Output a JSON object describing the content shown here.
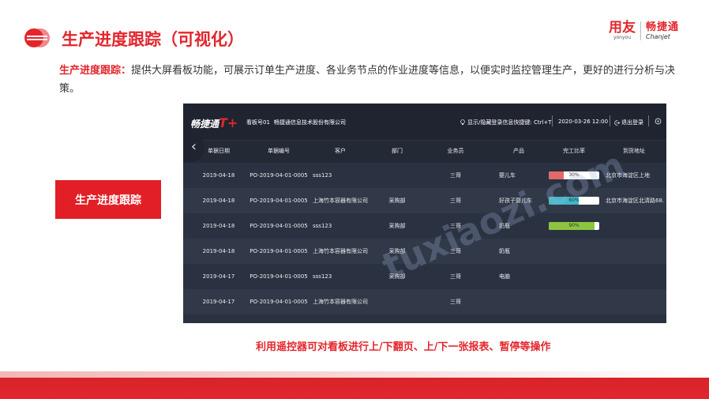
{
  "slide": {
    "title": "生产进度跟踪（可视化）",
    "brand": {
      "yonyou_cn": "用友",
      "yonyou_en": "yonyou",
      "chanjet_cn": "畅捷通",
      "chanjet_en": "Chanjet"
    },
    "desc_label": "生产进度跟踪：",
    "desc_text": "提供大屏看板功能，可展示订单生产进度、各业务节点的作业进度等信息，以便实时监控管理生产，更好的进行分析与决策。",
    "button_label": "生产进度跟踪",
    "caption": "利用遥控器可对看板进行上/下翻页、上/下一张报表、暂停等操作",
    "watermark": "tuxiaozi.com"
  },
  "board": {
    "logo": "畅捷通",
    "logo_suffix": "T+",
    "board_no": "看板号01",
    "company": "畅捷通信息技术股份有限公司",
    "hint": "显示/隐藏登录信息快捷键: Ctrl+T",
    "datetime": "2020-03-26 12:00",
    "logout": "退出登录",
    "columns": [
      "单据日期",
      "单据编号",
      "客户",
      "部门",
      "业务员",
      "产品",
      "完工比率",
      "到货地址"
    ],
    "rows": [
      {
        "date": "2019-04-18",
        "no": "PO-2019-04-01-0005",
        "customer": "sss123",
        "dept": "",
        "salesman": "三哥",
        "product": "婴儿车",
        "progress": "30%",
        "address": "北京市海淀区上地"
      },
      {
        "date": "2019-04-18",
        "no": "PO-2019-04-01-0005",
        "customer": "上海竹本容器有限公司",
        "dept": "采购部",
        "salesman": "三哥",
        "product": "好孩子婴儿车",
        "progress": "60%",
        "address": "北京市海淀区北清路68..."
      },
      {
        "date": "2019-04-18",
        "no": "PO-2019-04-01-0005",
        "customer": "sss123",
        "dept": "采购部",
        "salesman": "三哥",
        "product": "奶瓶",
        "progress": "90%",
        "address": ""
      },
      {
        "date": "2019-04-18",
        "no": "PO-2019-04-01-0005",
        "customer": "上海竹本容器有限公司",
        "dept": "采购部",
        "salesman": "三哥",
        "product": "奶瓶",
        "progress": "",
        "address": ""
      },
      {
        "date": "2019-04-17",
        "no": "PO-2019-04-01-0005",
        "customer": "sss123",
        "dept": "采购部",
        "salesman": "三哥",
        "product": "电脑",
        "progress": "",
        "address": ""
      },
      {
        "date": "2019-04-17",
        "no": "PO-2019-04-01-0005",
        "customer": "上海竹本容器有限公司",
        "dept": "",
        "salesman": "三哥",
        "product": "",
        "progress": "",
        "address": ""
      }
    ],
    "progress_colors": [
      "#e06a6a",
      "#3fb8c8",
      "#8cc63f"
    ]
  }
}
